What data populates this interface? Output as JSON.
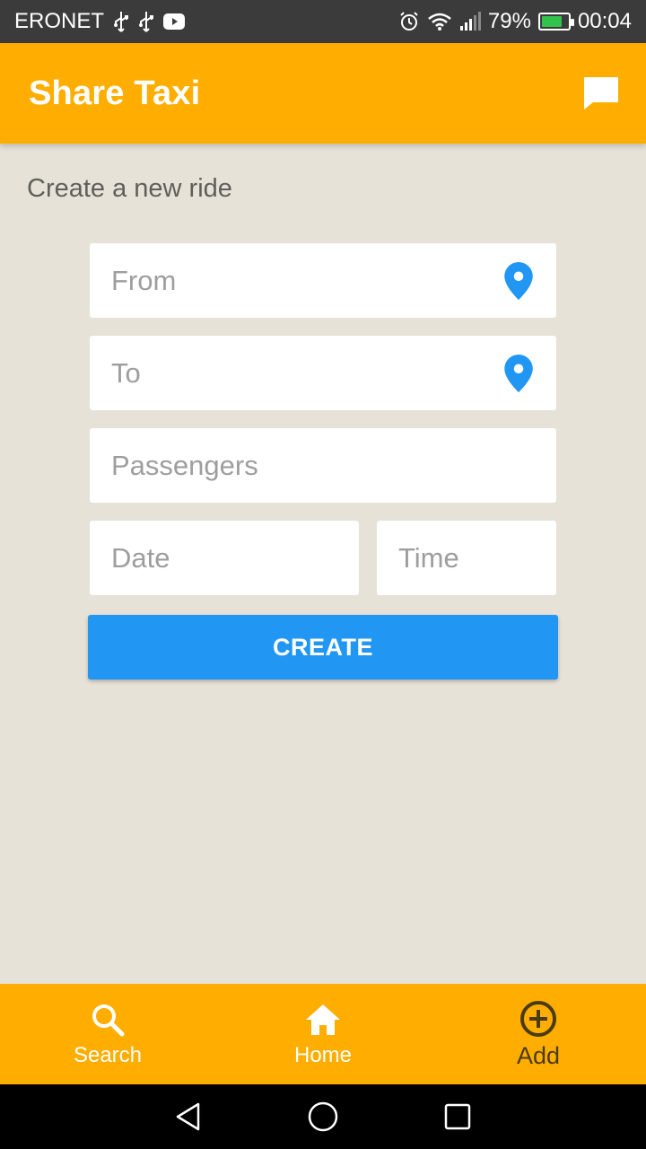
{
  "status_bar": {
    "carrier": "ERONET",
    "battery_percent": "79%",
    "time": "00:04",
    "battery_level": 0.79,
    "icons": [
      "usb-icon",
      "usb-icon",
      "youtube-icon",
      "alarm-icon",
      "wifi-icon",
      "signal-icon",
      "battery-icon"
    ]
  },
  "app_bar": {
    "title": "Share Taxi",
    "chat_icon": "chat-icon"
  },
  "form": {
    "section_title": "Create a new ride",
    "from_placeholder": "From",
    "to_placeholder": "To",
    "passengers_placeholder": "Passengers",
    "date_placeholder": "Date",
    "time_placeholder": "Time",
    "create_label": "CREATE"
  },
  "bottom_nav": {
    "items": [
      {
        "label": "Search",
        "icon": "search-icon"
      },
      {
        "label": "Home",
        "icon": "home-icon"
      },
      {
        "label": "Add",
        "icon": "add-circle-icon",
        "active": true
      }
    ]
  },
  "system_nav": [
    "back-icon",
    "home-circle-icon",
    "recents-icon"
  ],
  "colors": {
    "accent": "#ffae00",
    "primary": "#2196f3",
    "background": "#e6e2d8",
    "status_bar": "#3b3b3b"
  }
}
